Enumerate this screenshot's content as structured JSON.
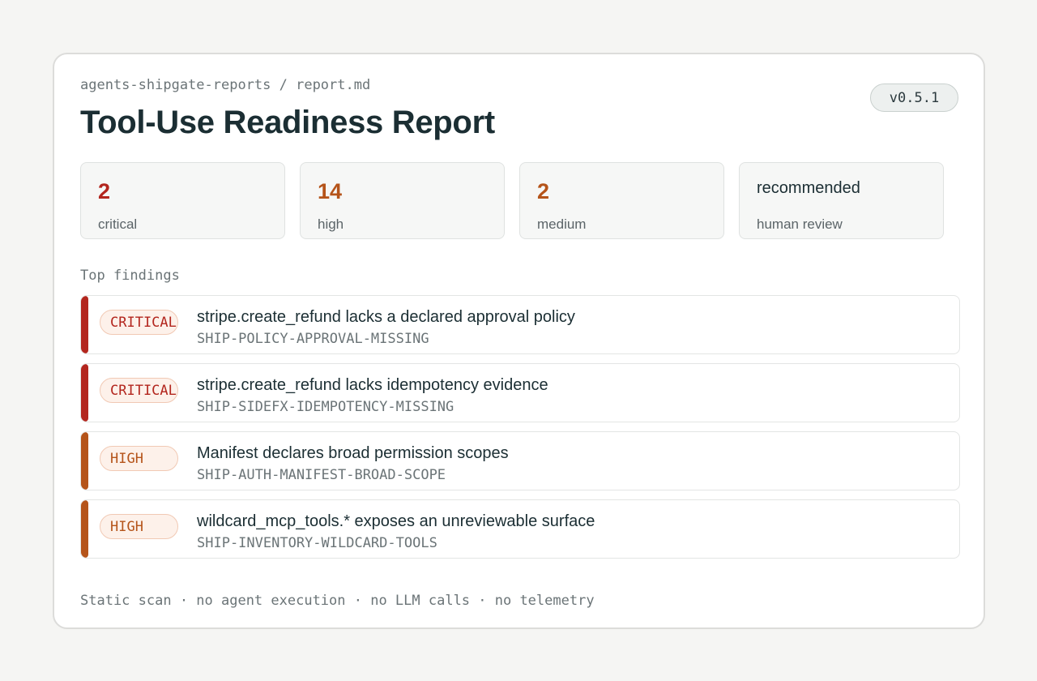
{
  "header": {
    "breadcrumb": "agents-shipgate-reports / report.md",
    "title": "Tool-Use Readiness Report",
    "version": "v0.5.1"
  },
  "stats": [
    {
      "value": "2",
      "label": "critical",
      "color": "#b3261e"
    },
    {
      "value": "14",
      "label": "high",
      "color": "#b5541a"
    },
    {
      "value": "2",
      "label": "medium",
      "color": "#b5541a"
    },
    {
      "value": "recommended",
      "label": "human review"
    }
  ],
  "findings_section": {
    "label": "Top findings",
    "items": [
      {
        "severity": "CRITICAL",
        "title": "stripe.create_refund lacks a declared approval policy",
        "code": "SHIP-POLICY-APPROVAL-MISSING"
      },
      {
        "severity": "CRITICAL",
        "title": "stripe.create_refund lacks idempotency evidence",
        "code": "SHIP-SIDEFX-IDEMPOTENCY-MISSING"
      },
      {
        "severity": "HIGH",
        "title": "Manifest declares broad permission scopes",
        "code": "SHIP-AUTH-MANIFEST-BROAD-SCOPE"
      },
      {
        "severity": "HIGH",
        "title": "wildcard_mcp_tools.* exposes an unreviewable surface",
        "code": "SHIP-INVENTORY-WILDCARD-TOOLS"
      }
    ]
  },
  "footer": "Static scan · no agent execution · no LLM calls · no telemetry",
  "colors": {
    "critical": "#b3261e",
    "high": "#b5541a",
    "background": "#f5f5f3"
  }
}
